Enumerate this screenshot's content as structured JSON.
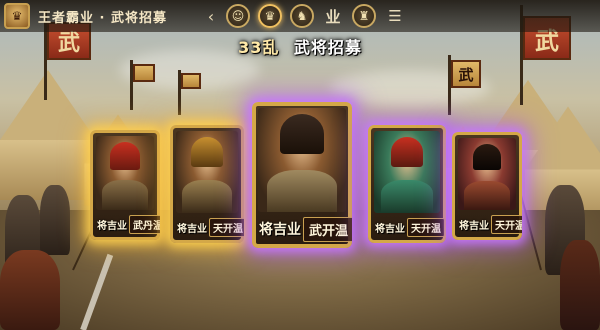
{
  "header": {
    "app_title": "王者霸业 · 武将招募",
    "avatar_icon": "general-portrait-icon",
    "nav": {
      "prev_icon": "chevron-left-icon",
      "tabs": [
        {
          "name": "soldier-tab",
          "icon": "helmet-icon",
          "glyph": "☺"
        },
        {
          "name": "general-tab",
          "icon": "general-portrait-icon",
          "glyph": "♛"
        },
        {
          "name": "cavalry-tab",
          "icon": "horse-icon",
          "glyph": "♞"
        },
        {
          "name": "industry-tab",
          "label": "业"
        },
        {
          "name": "army-tab",
          "icon": "troops-icon",
          "glyph": "♜"
        },
        {
          "name": "more-tab",
          "icon": "list-icon",
          "glyph": "☰"
        }
      ]
    }
  },
  "recruit": {
    "count": "33乱",
    "title": "武将招募"
  },
  "cards": [
    {
      "owner": "将吉业",
      "hero": "武丹温",
      "glow": "gold",
      "rarity": "gold"
    },
    {
      "owner": "将吉业",
      "hero": "天开温",
      "glow": "gold",
      "rarity": "gold"
    },
    {
      "owner": "将吉业",
      "hero": "武开温",
      "glow": "purple",
      "rarity": "featured"
    },
    {
      "owner": "将吉业",
      "hero": "天开温",
      "glow": "purple",
      "rarity": "purple"
    },
    {
      "owner": "将吉业",
      "hero": "天开温",
      "glow": "purple",
      "rarity": "purple"
    }
  ],
  "banners": [
    {
      "char": "武"
    },
    {
      "char": "武"
    },
    {
      "char": "武"
    }
  ],
  "colors": {
    "gold_glow": "#ffd250",
    "purple_glow": "#c878ff",
    "frame_gold": "#d4a848",
    "title_text": "#ffffff"
  }
}
